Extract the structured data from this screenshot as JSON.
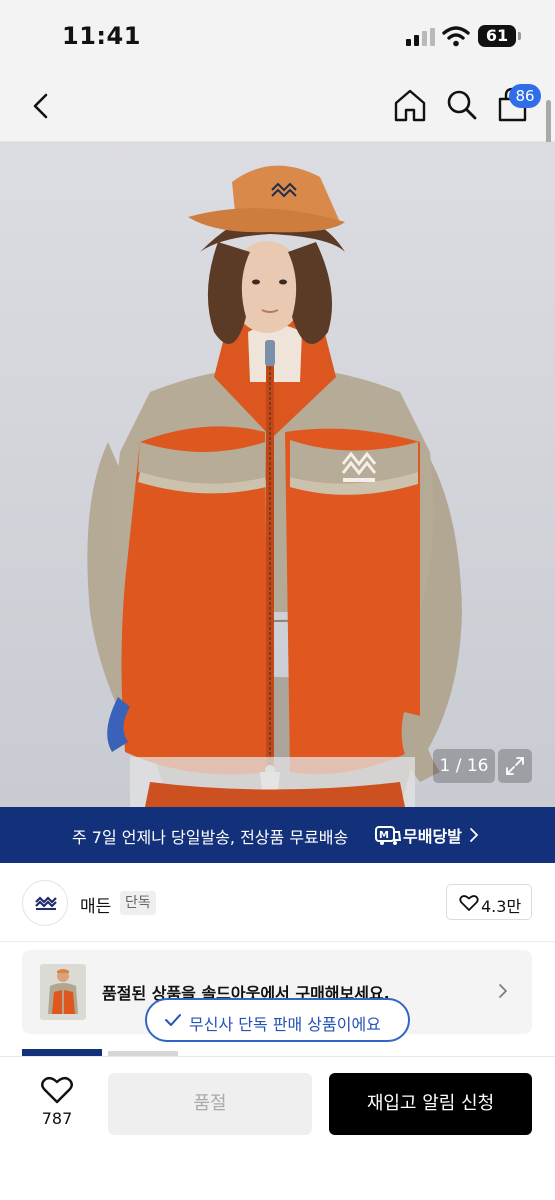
{
  "status_bar": {
    "time": "11:41",
    "battery": "61"
  },
  "nav": {
    "cart_count": "86"
  },
  "gallery": {
    "pager": "1 / 16",
    "image_alt": "manner-fleece-jacket-photo"
  },
  "delivery_banner": {
    "text": "주 7일 언제나 당일발송, 전상품 무료배송",
    "brand": "무배당발"
  },
  "brand": {
    "name": "매든",
    "tag": "단독",
    "likes": "4.3만"
  },
  "soldout_notice": {
    "text": "품절된 상품을 솔드아웃에서 구매해보세요."
  },
  "exclusive_chip": {
    "text": "무신사 단독 판매 상품이에요"
  },
  "bottom_bar": {
    "wish_count": "787",
    "soldout_label": "품절",
    "restock_label": "재입고 알림 신청"
  },
  "colors": {
    "banner_navy": "#13317a",
    "badge_blue": "#2f6ee8",
    "chip_blue": "#3165c5",
    "jacket_orange": "#e0561e",
    "jacket_khaki": "#b3a893"
  }
}
